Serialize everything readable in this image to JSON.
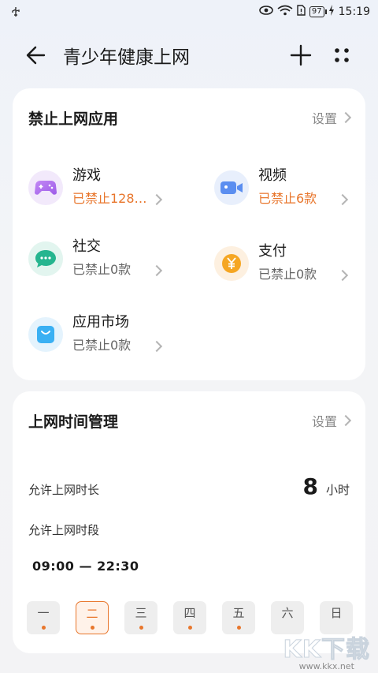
{
  "status_bar": {
    "time": "15:19",
    "battery": "97",
    "icons": [
      "usb-icon",
      "eye-icon",
      "wifi-icon",
      "sim-icon",
      "battery-icon",
      "charging-icon"
    ]
  },
  "header": {
    "title": "青少年健康上网",
    "back_icon": "arrow-left-icon",
    "add_icon": "plus-icon",
    "more_icon": "four-dots-icon"
  },
  "blocked_apps": {
    "title": "禁止上网应用",
    "setting_label": "设置",
    "categories": [
      {
        "name": "游戏",
        "status": "已禁止128…",
        "icon": "gamepad-icon",
        "highlight": true
      },
      {
        "name": "视频",
        "status": "已禁止6款",
        "icon": "video-camera-icon",
        "highlight": true
      },
      {
        "name": "社交",
        "status": "已禁止0款",
        "icon": "chat-bubble-icon",
        "highlight": false
      },
      {
        "name": "支付",
        "status": "已禁止0款",
        "icon": "yen-coin-icon",
        "highlight": false
      },
      {
        "name": "应用市场",
        "status": "已禁止0款",
        "icon": "shopping-bag-icon",
        "highlight": false
      }
    ]
  },
  "time_management": {
    "title": "上网时间管理",
    "setting_label": "设置",
    "duration_label": "允许上网时长",
    "duration_value": "8",
    "duration_unit": "小时",
    "period_label": "允许上网时段",
    "period_value": "09:00 — 22:30",
    "days": [
      {
        "label": "一",
        "selected": false
      },
      {
        "label": "二",
        "selected": true
      },
      {
        "label": "三",
        "selected": false
      },
      {
        "label": "四",
        "selected": false
      },
      {
        "label": "五",
        "selected": false
      },
      {
        "label": "六",
        "selected": false
      },
      {
        "label": "日",
        "selected": false
      }
    ]
  },
  "watermark": {
    "logo_text": "KK下载",
    "url": "www.kkx.net"
  },
  "colors": {
    "accent": "#e8762c",
    "card_bg": "#ffffff",
    "page_bg": "#f3f4f7"
  }
}
